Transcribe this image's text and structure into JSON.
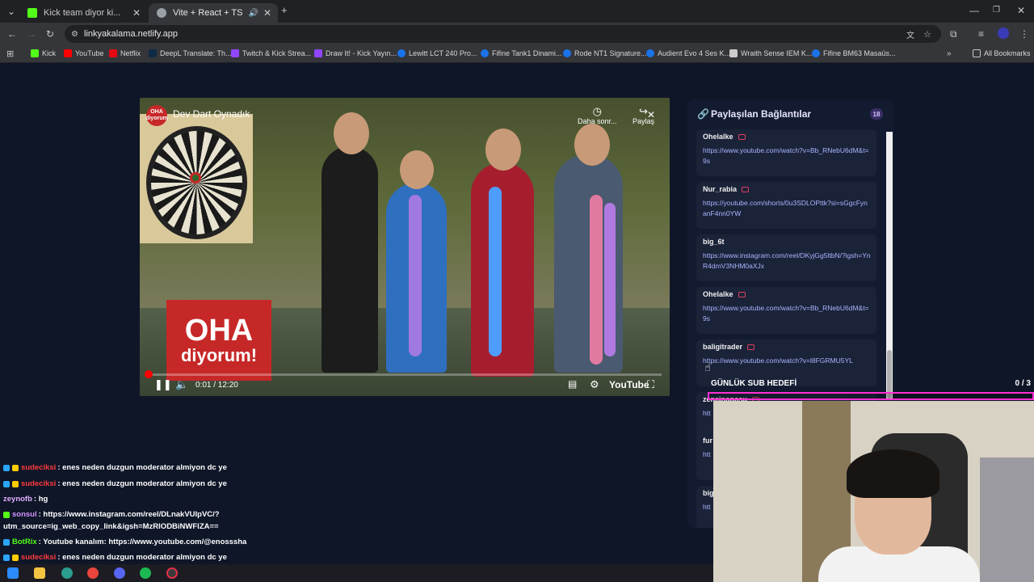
{
  "browser": {
    "tabs": [
      {
        "label": "Kick team diyor ki...",
        "favicon_color": "#53fc18",
        "active": false
      },
      {
        "label": "Vite + React + TS",
        "favicon_color": "#9aa0a6",
        "active": true
      }
    ],
    "new_tab_symbol": "+",
    "url": "linkyakalama.netlify.app",
    "bookmarks": [
      {
        "label": "Kick",
        "color": "#53fc18"
      },
      {
        "label": "YouTube",
        "color": "#ff0000"
      },
      {
        "label": "Netflix",
        "color": "#e50914"
      },
      {
        "label": "DeepL Translate: Th...",
        "color": "#0f2b46"
      },
      {
        "label": "Twitch & Kick Strea...",
        "color": "#9146ff"
      },
      {
        "label": "Draw It! - Kick Yayın...",
        "color": "#9146ff"
      },
      {
        "label": "Lewitt LCT 240 Pro...",
        "color": "#1a73e8"
      },
      {
        "label": "Fifine Tank1 Dinami...",
        "color": "#1a73e8"
      },
      {
        "label": "Rode NT1 Signature...",
        "color": "#1a73e8"
      },
      {
        "label": "Audient Evo 4 Ses K...",
        "color": "#1a73e8"
      },
      {
        "label": "Wraith Sense IEM K...",
        "color": "#cccccc"
      },
      {
        "label": "Fifine BM63 Masaüs...",
        "color": "#1a73e8"
      }
    ],
    "all_bookmarks": "All Bookmarks"
  },
  "video": {
    "title": "Dev Dart Oynadık",
    "channel_badge": "OHA diyorum",
    "watch_later": "Daha sonr...",
    "share": "Paylaş",
    "time": "0:01 / 12:20",
    "progress": 0.0014,
    "platform": "YouTube",
    "logo_line1": "OHA",
    "logo_line2": "diyorum!"
  },
  "panel": {
    "title": "Paylaşılan Bağlantılar",
    "count": "18",
    "links": [
      {
        "user": "Ohelalke",
        "youtube": true,
        "url": "https://www.youtube.com/watch?v=Bb_RNebU6dM&t=9s"
      },
      {
        "user": "Nur_rabia",
        "youtube": true,
        "url": "https://youtube.com/shorts/0u3SDLOPttk?si=sGgcFynanF4nn0YW"
      },
      {
        "user": "big_6t",
        "youtube": false,
        "url": "https://www.instagram.com/reel/DKyjGg5ltbN/?igsh=YnR4dmV3NHM0aXJx"
      },
      {
        "user": "Ohelalke",
        "youtube": true,
        "url": "https://www.youtube.com/watch?v=Bb_RNebU6dM&t=9s"
      },
      {
        "user": "baligitrader",
        "youtube": true,
        "url": "https://www.youtube.com/watch?v=l8FGRMU5YL"
      },
      {
        "user": "zencinonosu",
        "youtube": true,
        "url": "htt"
      },
      {
        "user": "fur",
        "youtube": false,
        "url": "htt"
      },
      {
        "user": "big",
        "youtube": false,
        "url": "htt"
      }
    ]
  },
  "subgoal": {
    "label": "GÜNLÜK SUB HEDEFİ",
    "count": "0 / 3",
    "progress": 0
  },
  "chat": [
    {
      "user": "sudeciksi",
      "user_color": "#ff3b3b",
      "badges": [
        "#2aa6ff",
        "#ffcc00"
      ],
      "text": ": enes neden duzgun moderator almiyon dc ye"
    },
    {
      "user": "sudeciksi",
      "user_color": "#ff3b3b",
      "badges": [
        "#2aa6ff",
        "#ffcc00"
      ],
      "text": ": enes neden duzgun moderator almiyon dc ye"
    },
    {
      "user": "zeynofb",
      "user_color": "#e0b0ff",
      "badges": [],
      "text": ": hg"
    },
    {
      "user": "sonsul",
      "user_color": "#d090ff",
      "badges": [
        "#53fc18"
      ],
      "text": ": https://www.instagram.com/reel/DLnakVUIpVC/?"
    },
    {
      "user": "",
      "user_color": "#ffffff",
      "badges": [],
      "text": "utm_source=ig_web_copy_link&igsh=MzRlODBiNWFlZA=="
    },
    {
      "user": "BotRix",
      "user_color": "#53fc18",
      "badges": [
        "#2aa6ff"
      ],
      "text": ": Youtube kanalım: https://www.youtube.com/@enosssha"
    },
    {
      "user": "sudeciksi",
      "user_color": "#ff3b3b",
      "badges": [
        "#2aa6ff",
        "#ffcc00"
      ],
      "text": ": enes neden duzgun moderator almiyon dc ye"
    }
  ]
}
